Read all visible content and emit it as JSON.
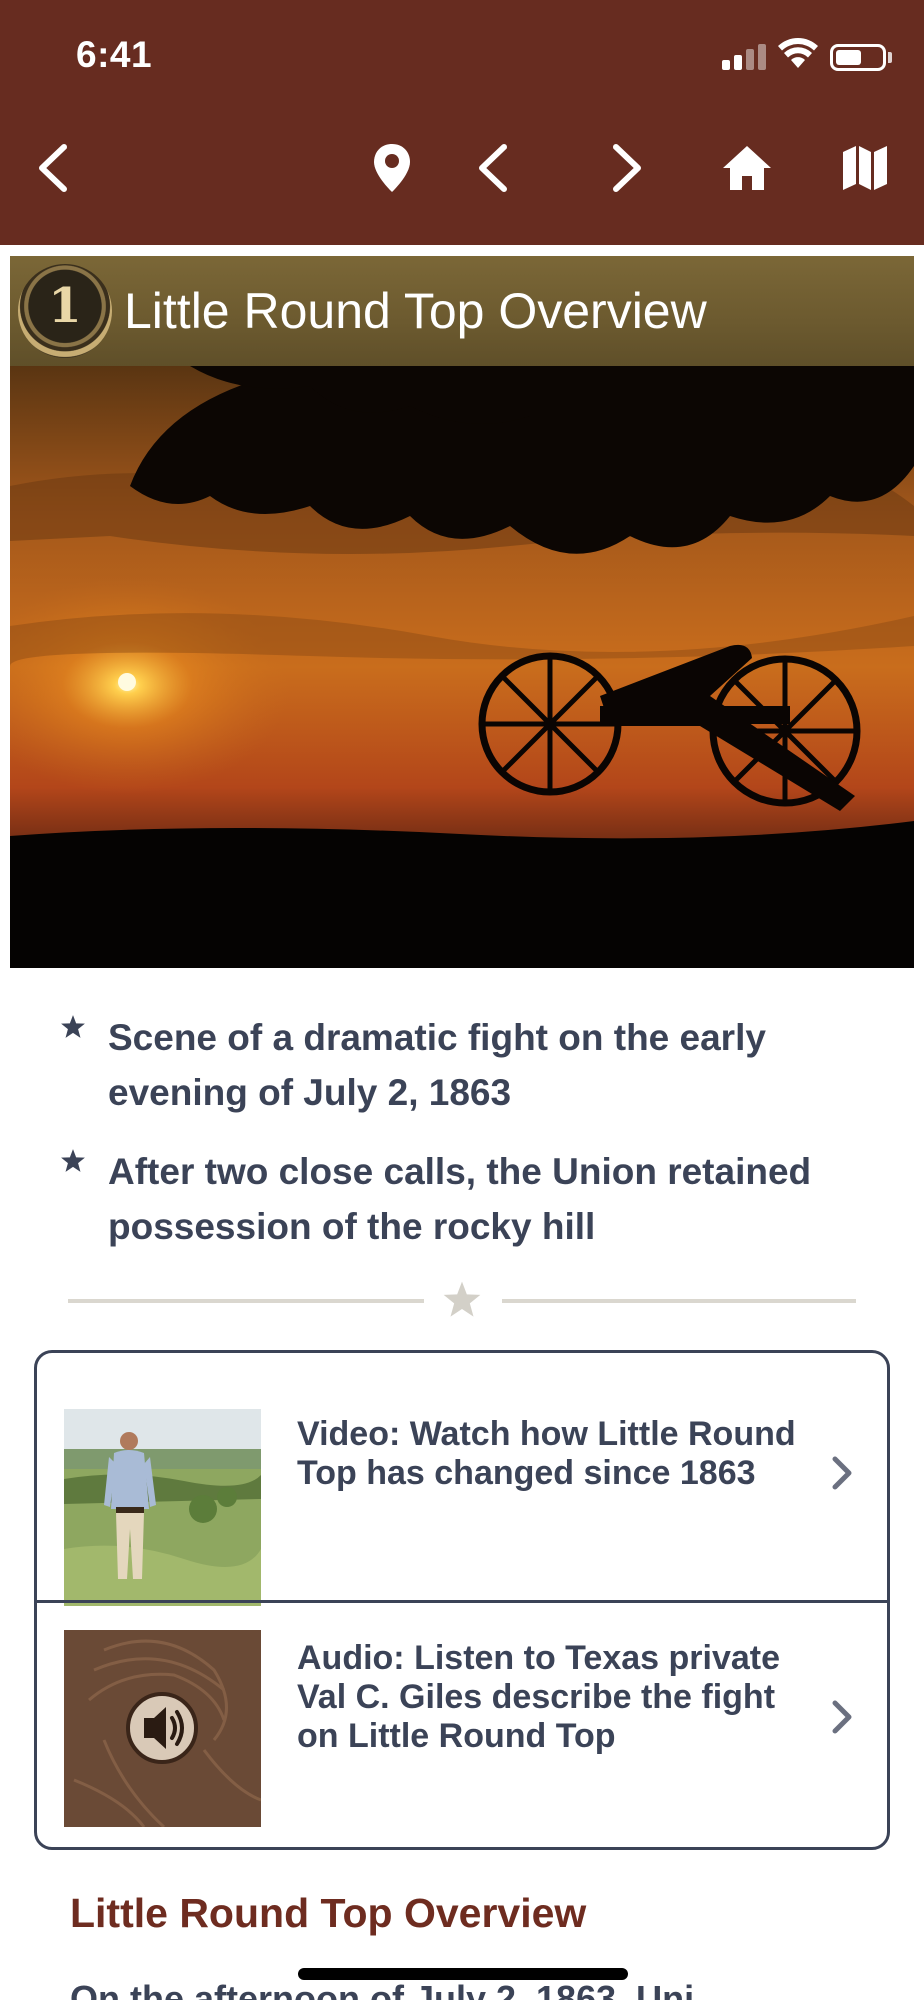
{
  "status_bar": {
    "time": "6:41",
    "icons": [
      "signal-icon",
      "wifi-icon",
      "battery-icon"
    ]
  },
  "nav": {
    "buttons": [
      "back-icon",
      "location-pin-icon",
      "previous-icon",
      "next-icon",
      "home-icon",
      "map-icon"
    ]
  },
  "stop": {
    "number": "1",
    "title": "Little Round Top Overview"
  },
  "hero_image": {
    "description_icon": "cannon-sunset-photo"
  },
  "bullets": [
    "Scene of a dramatic fight on the early evening of July 2, 1863",
    "After two close calls, the Union retained possession of the rocky hill"
  ],
  "media": [
    {
      "label": "Video: Watch how Little Round Top has changed since 1863",
      "thumbnail": "video-thumbnail-man-in-field",
      "chevron": "chevron-right-icon"
    },
    {
      "label": "Audio: Listen to Texas private Val C. Giles describe the fight on Little Round Top",
      "thumbnail": "audio-thumbnail-speaker",
      "chevron": "chevron-right-icon"
    }
  ],
  "section": {
    "heading": "Little Round Top Overview",
    "partial_text": "On the afternoon of July 2, 1863, Uni"
  },
  "colors": {
    "header": "#672c20",
    "title_band": "#6c5a2f",
    "text": "#3b4357",
    "heading": "#6e2c20"
  }
}
